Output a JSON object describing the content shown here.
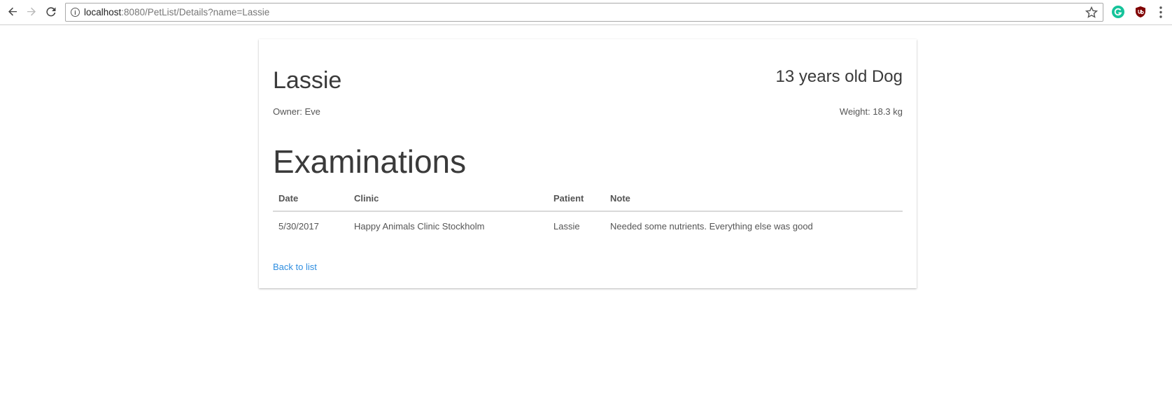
{
  "browser": {
    "url_host": "localhost",
    "url_rest": ":8080/PetList/Details?name=Lassie",
    "icons": [
      "back-arrow-icon",
      "forward-arrow-icon",
      "reload-icon",
      "info-icon",
      "star-icon",
      "grammarly-icon",
      "ublock-icon",
      "menu-icon"
    ],
    "info_glyph": "i"
  },
  "pet": {
    "name": "Lassie",
    "age_species": "13 years old Dog",
    "owner": "Owner: Eve",
    "weight": "Weight: 18.3 kg"
  },
  "examinations": {
    "title": "Examinations",
    "columns": [
      "Date",
      "Clinic",
      "Patient",
      "Note"
    ],
    "rows": [
      [
        "5/30/2017",
        "Happy Animals Clinic Stockholm",
        "Lassie",
        "Needed some nutrients. Everything else was good"
      ]
    ]
  },
  "back_link": "Back to list",
  "colors": {
    "link": "#2f8ee0",
    "text": "#3a3a3a",
    "grammarly": "#15c39a",
    "ublock": "#800000"
  }
}
